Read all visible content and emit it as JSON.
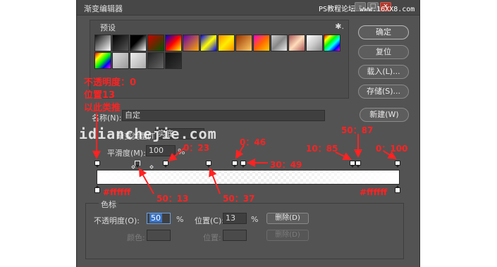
{
  "window": {
    "title": "渐变编辑器",
    "watermark": "PS教程论坛 www.16XX8.com"
  },
  "presets": {
    "label": "预设",
    "gear": "✱."
  },
  "buttons": {
    "ok": "确定",
    "reset": "复位",
    "load": "载入(L)...",
    "save": "存储(S)...",
    "new": "新建(W)"
  },
  "name": {
    "label": "名称(N):",
    "value": "自定"
  },
  "type": {
    "label": "渐变类型(T):",
    "value": "实底"
  },
  "smoothness": {
    "label": "平滑度(M):",
    "value": "100",
    "unit": "%"
  },
  "stops_group": {
    "title": "色标",
    "opacity_label": "不透明度(O):",
    "opacity_value": "50",
    "opacity_unit": "%",
    "location_label": "位置(C):",
    "location_value": "13",
    "location_unit": "%",
    "delete_label": "删除(D)",
    "color_label": "颜色:",
    "color_location_label": "位置:",
    "color_delete_label": "删除(D)"
  },
  "site_watermark": "idianchejie.com",
  "annotations": {
    "note_line1": "不透明度：0",
    "note_line2": "位置13",
    "note_line3": "以此类推",
    "a1": "0：23",
    "a2": "0：46",
    "a3": "50：87",
    "a4": "30：49",
    "a5": "10：85",
    "a6": "0：100",
    "a7": "#ffffff",
    "a8": "50：13",
    "a9": "50：37",
    "a10": "#ffffff"
  },
  "colors": {
    "accent": "#ff2222",
    "dialog_bg": "#535353"
  }
}
